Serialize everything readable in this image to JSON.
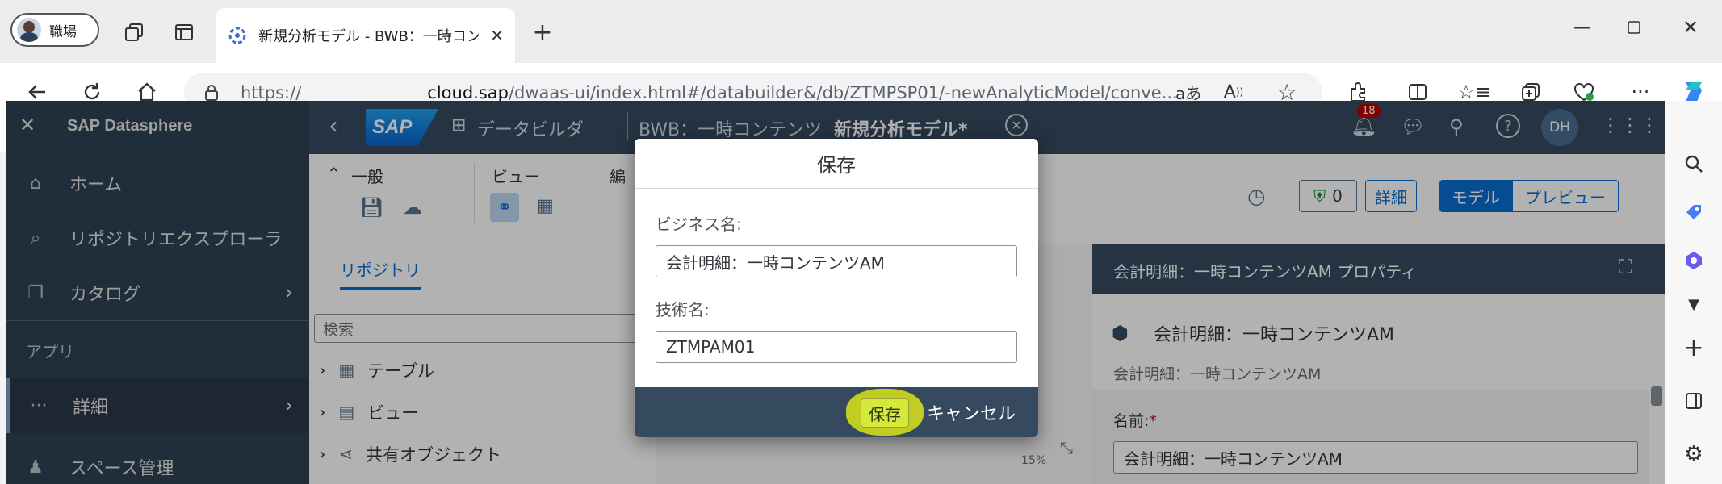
{
  "browser": {
    "profile_label": "職場",
    "tab_title": "新規分析モデル - BWB：一時コンテ",
    "url_prefix": "https://",
    "url_domain": "cloud.sap",
    "url_rest": "/dwaas-ui/index.html#/databuilder&/db/ZTMPSP01/-newAnalyticModel/conve...",
    "read_aloud": "aあ"
  },
  "shell": {
    "app_title": "SAP Datasphere",
    "logo_text": "SAP",
    "crumb_builder": "データビルダ",
    "crumb_space": "BWB：一時コンテンツ",
    "crumb_model": "新規分析モデル*",
    "notif_count": "18",
    "avatar": "DH"
  },
  "sidenav": {
    "items": [
      {
        "label": "ホーム"
      },
      {
        "label": "リポジトリエクスプローラ"
      },
      {
        "label": "カタログ"
      }
    ],
    "section": "アプリ",
    "detail": "詳細",
    "space": "スペース管理"
  },
  "toolbar": {
    "general": "一般",
    "view": "ビュー",
    "edit_trunc": "編",
    "badge_count": "0",
    "details_btn": "詳細",
    "model_btn": "モデル",
    "preview_btn": "プレビュー"
  },
  "repo": {
    "tab": "リポジトリ",
    "search_placeholder": "検索",
    "tree": [
      {
        "label": "テーブル"
      },
      {
        "label": "ビュー"
      },
      {
        "label": "共有オブジェクト"
      }
    ]
  },
  "canvas": {
    "zoom": "15%"
  },
  "props": {
    "header": "会計明細：一時コンテンツAM プロパティ",
    "object_title": "会計明細：一時コンテンツAM",
    "object_subtitle": "会計明細：一時コンテンツAM",
    "name_label": "名前:",
    "name_value": "会計明細：一時コンテンツAM"
  },
  "dialog": {
    "title": "保存",
    "business_name_label": "ビジネス名:",
    "business_name_value": "会計明細：一時コンテンツAM",
    "technical_name_label": "技術名:",
    "technical_name_value": "ZTMPAM01",
    "save_label": "保存",
    "cancel_label": "キャンセル"
  },
  "colors": {
    "shell": "#354a5f",
    "save_highlight": "#e6ee14",
    "redaction": "#ffff00"
  }
}
